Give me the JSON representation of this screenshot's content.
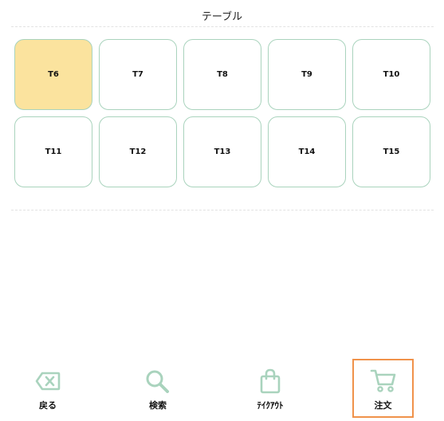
{
  "header": {
    "title": "テーブル"
  },
  "tables": [
    "T6",
    "T7",
    "T8",
    "T9",
    "T10",
    "T11",
    "T12",
    "T13",
    "T14",
    "T15"
  ],
  "selected_table": "T6",
  "nav": {
    "back": "戻る",
    "search": "検索",
    "takeout": "ﾃｲｸｱｳﾄ",
    "order": "注文"
  },
  "colors": {
    "accent_green": "#a9d3bd",
    "selected_fill": "#fbe39e",
    "active_border": "#f0924a"
  }
}
